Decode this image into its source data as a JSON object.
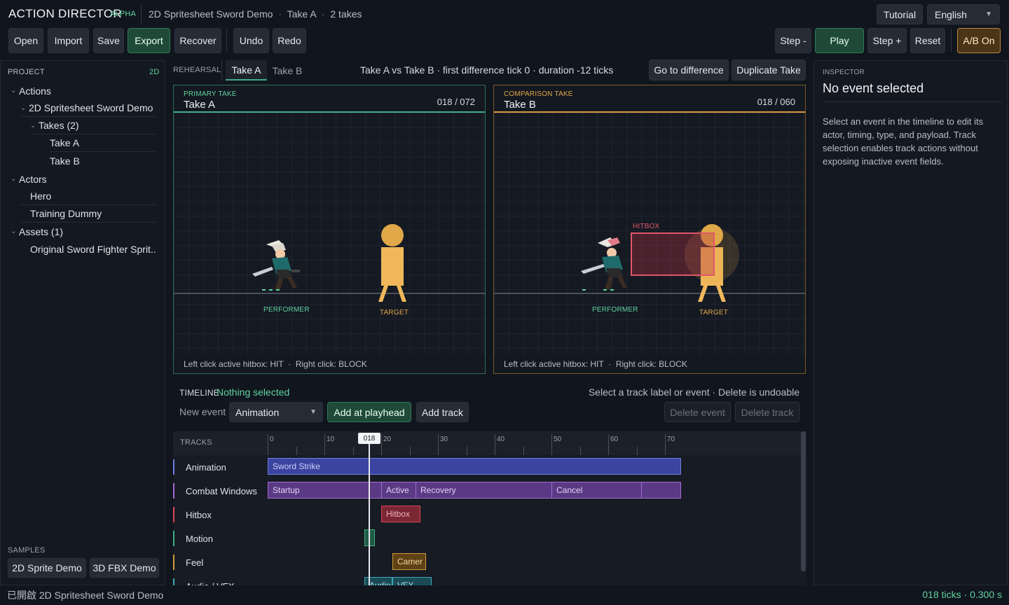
{
  "header": {
    "app_title": "ACTION DIRECTOR",
    "badge": "ALPHA",
    "project": "2D Spritesheet Sword Demo",
    "take": "Take A",
    "takes_count": "2 takes",
    "dot": "·",
    "tutorial": "Tutorial",
    "language": "English"
  },
  "toolbar": {
    "open": "Open",
    "import": "Import",
    "save": "Save",
    "export": "Export",
    "recover": "Recover",
    "undo": "Undo",
    "redo": "Redo",
    "step_back": "Step -",
    "play": "Play",
    "step_fwd": "Step +",
    "reset": "Reset",
    "ab": "A/B On"
  },
  "sidebar": {
    "title": "PROJECT",
    "mode": "2D",
    "tree": [
      {
        "label": "Actions"
      },
      {
        "label": "2D Spritesheet Sword Demo"
      },
      {
        "label": "Takes (2)"
      },
      {
        "label": "Take A"
      },
      {
        "label": "Take B"
      },
      {
        "label": "Actors"
      },
      {
        "label": "Hero"
      },
      {
        "label": "Training Dummy"
      },
      {
        "label": "Assets (1)"
      },
      {
        "label": "Original Sword Fighter Sprit..."
      }
    ],
    "samples_title": "SAMPLES",
    "sample_2d": "2D Sprite Demo",
    "sample_3d": "3D FBX Demo"
  },
  "rehearsal": {
    "label": "REHEARSAL",
    "tab_a": "Take A",
    "tab_b": "Take B",
    "summary": "Take A vs Take B · first difference tick 0 · duration -12 ticks",
    "go_diff": "Go to difference",
    "duplicate": "Duplicate Take"
  },
  "viewports": {
    "primary": {
      "kind": "PRIMARY TAKE",
      "name": "Take A",
      "frame": "018 / 072",
      "performer": "PERFORMER",
      "target": "TARGET",
      "hint": "Left click active hitbox: HIT  ·  Right click: BLOCK",
      "accent": "#3fae84"
    },
    "comparison": {
      "kind": "COMPARISON TAKE",
      "name": "Take B",
      "frame": "018 / 060",
      "performer": "PERFORMER",
      "target": "TARGET",
      "hitbox": "HITBOX",
      "hint": "Left click active hitbox: HIT  ·  Right click: BLOCK",
      "accent": "#d79a3c"
    }
  },
  "timeline": {
    "title": "TIMELINE",
    "status": "Nothing selected",
    "hint": "Select a track label or event · Delete is undoable",
    "new_event_label": "New event",
    "new_event_type": "Animation",
    "add_at_playhead": "Add at playhead",
    "add_track": "Add track",
    "delete_event": "Delete event",
    "delete_track": "Delete track",
    "tracks_header": "TRACKS",
    "playhead": "018",
    "ticks": [
      "0",
      "10",
      "20",
      "30",
      "40",
      "50",
      "60",
      "70"
    ],
    "tracks": [
      {
        "label": "Animation",
        "color": "#6f7de0"
      },
      {
        "label": "Combat Windows",
        "color": "#a46ad6"
      },
      {
        "label": "Hitbox",
        "color": "#d9475a"
      },
      {
        "label": "Motion",
        "color": "#3fae84"
      },
      {
        "label": "Feel",
        "color": "#d79a3c"
      },
      {
        "label": "Audio / VFX",
        "color": "#3aa7b8"
      }
    ],
    "events": {
      "sword_strike": "Sword Strike",
      "startup": "Startup",
      "active": "Active",
      "recovery": "Recovery",
      "cancel": "Cancel",
      "hitbox": "Hitbox",
      "camera": "Camer",
      "audio": "Audio",
      "vfx": "VFX"
    }
  },
  "inspector": {
    "title": "INSPECTOR",
    "heading": "No event selected",
    "body": "Select an event in the timeline to edit its actor, timing, type, and payload. Track selection enables track actions without exposing inactive event fields."
  },
  "status_bar": {
    "left": "已開啟 2D Spritesheet Sword Demo",
    "right": "018 ticks · 0.300 s"
  }
}
